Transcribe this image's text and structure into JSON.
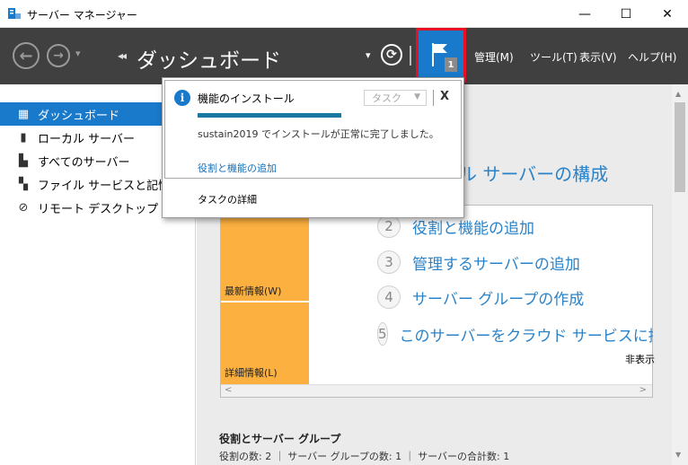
{
  "window": {
    "title": "サーバー マネージャー",
    "minimize_icon": "—",
    "maximize_icon": "☐",
    "close_icon": "✕"
  },
  "toolbar": {
    "breadcrumb_arrows": "◂◂",
    "page_title": "ダッシュボード",
    "dropdown_arrow": "▾",
    "refresh_icon": "⟳",
    "notification_count": "1",
    "menus": [
      "管理(M)",
      "ツール(T)",
      "表示(V)",
      "ヘルプ(H)"
    ]
  },
  "sidebar": {
    "items": [
      {
        "label": "ダッシュボード",
        "icon": "dashboard-icon",
        "selected": true
      },
      {
        "label": "ローカル サーバー",
        "icon": "server-icon"
      },
      {
        "label": "すべてのサーバー",
        "icon": "servers-icon"
      },
      {
        "label": "ファイル サービスと記憶域",
        "icon": "file-services-icon"
      },
      {
        "label": "リモート デスクトップ サービス",
        "icon": "remote-desktop-icon"
      }
    ]
  },
  "main": {
    "heading_fragment": "ル サーバーの構成",
    "steps": [
      {
        "num": "2",
        "label": "役割と機能の追加"
      },
      {
        "num": "3",
        "label": "管理するサーバーの追加"
      },
      {
        "num": "4",
        "label": "サーバー グループの作成"
      },
      {
        "num": "5",
        "label": "このサーバーをクラウド サービスに接続す"
      }
    ],
    "orange_labels": [
      "最新情報(W)",
      "詳細情報(L)"
    ],
    "hide_link": "非表示",
    "scroll_left": "<",
    "scroll_right": ">",
    "roles_title": "役割とサーバー グループ",
    "roles_stats": "役割の数: 2 ｜ サーバー グループの数: 1 ｜ サーバーの合計数: 1"
  },
  "notification": {
    "title": "機能のインストール",
    "task_label": "タスク",
    "close_label": "X",
    "progress": 1.0,
    "message": "sustain2019 でインストールが正常に完了しました。",
    "link": "役割と機能の追加",
    "task_details": "タスクの詳細"
  },
  "colors": {
    "accent": "#1979ca",
    "toolbar_bg": "#404040",
    "highlight_border": "#e81123",
    "orange_tile": "#fbb040"
  }
}
